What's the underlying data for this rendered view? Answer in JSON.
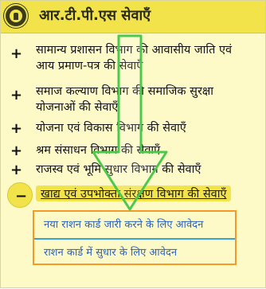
{
  "header": {
    "title": "आर.टी.पी.एस सेवाएँ"
  },
  "menu": {
    "items": [
      {
        "label_line1": "सामान्य प्रशासन विभाग की आवासीय जाति एवं",
        "label_line2": "आय प्रमाण-पत्र की सेवाएँ"
      },
      {
        "label_line1": "समाज कल्याण विभाग की समाजिक सुरक्षा",
        "label_line2": "योजनाओं की सेवाएँ"
      },
      {
        "label_line1": "योजना एवं विकास विभाग की सेवाएँ",
        "label_line2": ""
      },
      {
        "label_line1": "श्रम संसाधन विभाग की सेवाएँ",
        "label_line2": ""
      },
      {
        "label_line1": "राजस्व एवं भूमि सुधार विभाग की सेवाएँ",
        "label_line2": ""
      }
    ],
    "active": {
      "label": "खाद्य एवं उपभोक्ता संरक्षण विभाग की सेवाएँ",
      "symbol": "−",
      "subitems": [
        {
          "label": "नया राशन कार्ड जारी करने के लिए आवेदन"
        },
        {
          "label": "राशन कार्ड में सुधार के लिए आवेदन"
        }
      ]
    }
  },
  "colors": {
    "header_bg": "#f3e34a",
    "panel_bg": "#fefac8",
    "arrow": "#4cc94c",
    "highlight_border": "#f39a2b",
    "link": "#2b62c0"
  },
  "icons": {
    "logo": "emblem-icon",
    "expand": "plus-icon",
    "collapse": "minus-icon",
    "annotation": "down-arrow-icon"
  }
}
